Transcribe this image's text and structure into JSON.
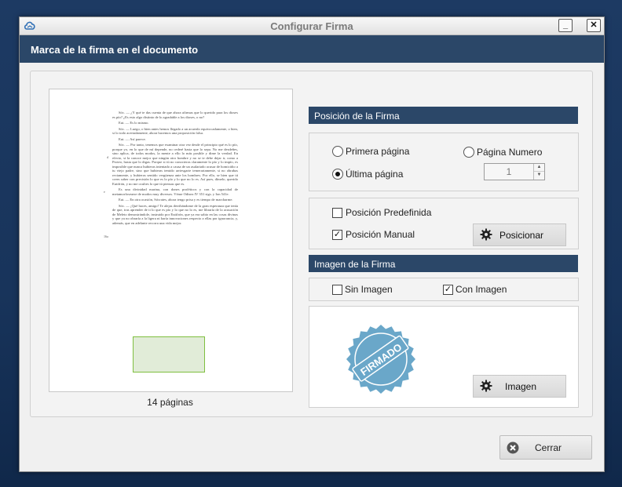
{
  "window": {
    "title": "Configurar Firma",
    "minimize_symbol": "_",
    "close_symbol": "✕"
  },
  "header": {
    "title": "Marca de la firma en el documento"
  },
  "preview": {
    "pages_label": "14 páginas",
    "paragraphs": [
      "Sóc. — ¿Y qué te das cuenta de que ahora afirmas que lo querido para los dioses es pío? ¿Es esto algo distinto de lo agradable a los dioses, o no?",
      "Eut. — Es lo mismo.",
      "Sóc. — Luego, o bien antes hemos llegado a un acuerdo equivocadamente, o bien, si lo todo acertadamente, ahora hacemos una proposición falsa.",
      "Eut. — Así parece.",
      "Sóc. — Por tanto, tenemos que examinar otra vez desde el principio qué es lo pío, porque yo, en lo que de mí depende, no cederé hasta que lo sepa. No me desdeñes, sino aplica, de todos modos, la mente a ello lo más posible y dime la verdad. En efecto, si la conoce mejor que ningún otro hombre y no se te debe dejar ir, como a Proteo, hasta que lo digas. Porque si tú no conocieras claramente lo pío y lo impío, es imposible que nunca hubieras intentado a causa de un asalariado acusar de homicidio a tu viejo padre, sino que hubieras temido arriesgarte temerariamente, si no obrabas rectamente, y hubieras sentido vergüenza ante los hombres. Por ello, se bien que tú crees saber con precisión lo que es lo pío y lo que no lo es. Así pues, dímelo, querido Eutifrón, y no me ocultes lo que tú piensas que es.",
      "Es una divinidad marina, con dones proféticos y con la capacidad de metamorfosearse de modos muy diversos. Véase Odisea IV 351 sigs. y Ion 541e.",
      "Eut. — En otra ocasión, Sócrates, ahora tengo prisa y es tiempo de marcharme.",
      "Sóc. — ¡Qué haces, amigo! Te alejas derribándome de la gran esperanza que tenía de que, tras aprender de ti lo que es pío y lo que no lo es, me libraría de la acusación de Meleto demostrándole, instruido por Eutifrón, que ya era sabio en las cosas divinas y que ya no obraría a la ligera ni haría innovaciones respecto a ellas por ignorancia, y, además, que en adelante recorra una vida mejor."
    ],
    "margin_notes": [
      "d",
      "e",
      "16a",
      "e"
    ]
  },
  "position_section": {
    "title": "Posición de la Firma",
    "first_page_label": "Primera página",
    "last_page_label": "Última página",
    "page_number_label": "Página Numero",
    "page_number_value": "1",
    "selected": "last_page"
  },
  "mode_section": {
    "predefined_label": "Posición Predefinida",
    "predefined_checked": false,
    "manual_label": "Posición Manual",
    "manual_checked": true,
    "position_button_label": "Posicionar"
  },
  "image_section": {
    "title": "Imagen de la Firma",
    "no_image_label": "Sin Imagen",
    "no_image_checked": false,
    "with_image_label": "Con Imagen",
    "with_image_checked": true,
    "stamp_text": "FIRMADO",
    "image_button_label": "Imagen"
  },
  "footer": {
    "close_button_label": "Cerrar"
  },
  "colors": {
    "header_bg": "#2b4768",
    "stamp_blue": "#6aa7c9",
    "signature_box_fill": "#e1ecd8",
    "signature_box_border": "#7fbf3f"
  },
  "icons": {
    "app": "cloud-signature-icon",
    "settings": "gear-icon",
    "close": "close-circle-icon"
  }
}
